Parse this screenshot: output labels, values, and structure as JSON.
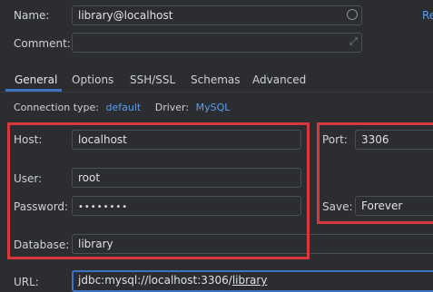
{
  "general": {
    "name_label": "Name:",
    "name_value": "library@localhost",
    "comment_label": "Comment:",
    "comment_value": "",
    "reset_link": "Re"
  },
  "tabs": [
    {
      "label": "General",
      "active": true
    },
    {
      "label": "Options"
    },
    {
      "label": "SSH/SSL"
    },
    {
      "label": "Schemas"
    },
    {
      "label": "Advanced"
    }
  ],
  "connection": {
    "type_label": "Connection type:",
    "type_value": "default",
    "driver_label": "Driver:",
    "driver_value": "MySQL"
  },
  "fields": {
    "host_label": "Host:",
    "host_value": "localhost",
    "port_label": "Port:",
    "port_value": "3306",
    "user_label": "User:",
    "user_value": "root",
    "password_label": "Password:",
    "password_value": "••••••••",
    "save_label": "Save:",
    "save_value": "Forever",
    "database_label": "Database:",
    "database_value": "library",
    "url_label": "URL:",
    "url_prefix": "jdbc:mysql://localhost:3306/",
    "url_db": "library"
  },
  "colors": {
    "background": "#2b2d30",
    "accent": "#3d74c4",
    "link": "#589df6",
    "highlight_box": "#d9373e"
  }
}
